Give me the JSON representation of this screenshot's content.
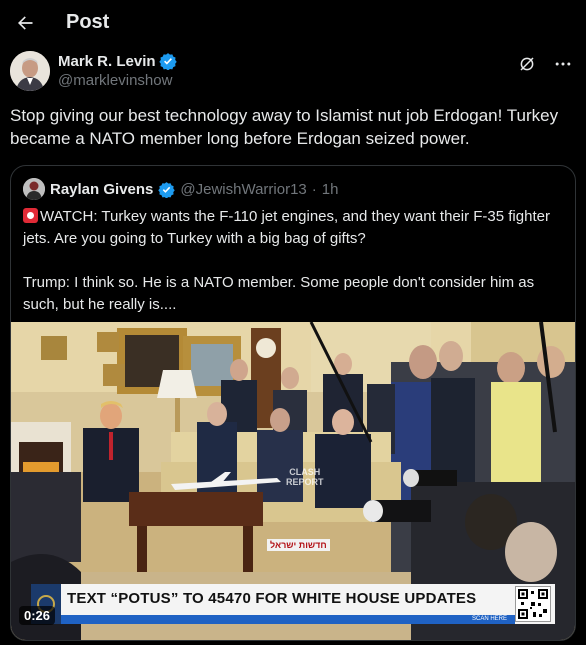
{
  "header": {
    "title": "Post",
    "back_icon": "arrow-left-icon"
  },
  "post": {
    "author_name": "Mark R. Levin",
    "author_handle": "@marklevinshow",
    "verified": true,
    "text": "Stop giving our best technology away to Islamist nut job Erdogan!  Turkey\nbecame a NATO member long before Erdogan seized power.",
    "icons": [
      "grok-icon",
      "more-icon"
    ]
  },
  "quote": {
    "author_name": "Raylan Givens",
    "author_handle": "@JewishWarrior13",
    "separator": "·",
    "time": "1h",
    "verified": true,
    "text": "WATCH: Turkey wants the F-110 jet engines, and they want their F-35 fighter\njets. Are you going to Turkey with a big bag of gifts?\n\nTrump: I think so. He is a NATO member. Some people don't consider him as\nsuch, but he really is....",
    "media": {
      "banner_text": "TEXT “POTUS” TO 45470 FOR WHITE HOUSE UPDATES",
      "banner_scan": "SCAN HERE",
      "watermark": "CLASH\nREPORT",
      "hebrew_tag": "חדשות ישראל",
      "video_time": "0:26"
    }
  },
  "colors": {
    "background": "#000000",
    "text": "#e7e9ea",
    "muted": "#71767b",
    "verified": "#1d9bf0",
    "border": "#2f3336"
  }
}
